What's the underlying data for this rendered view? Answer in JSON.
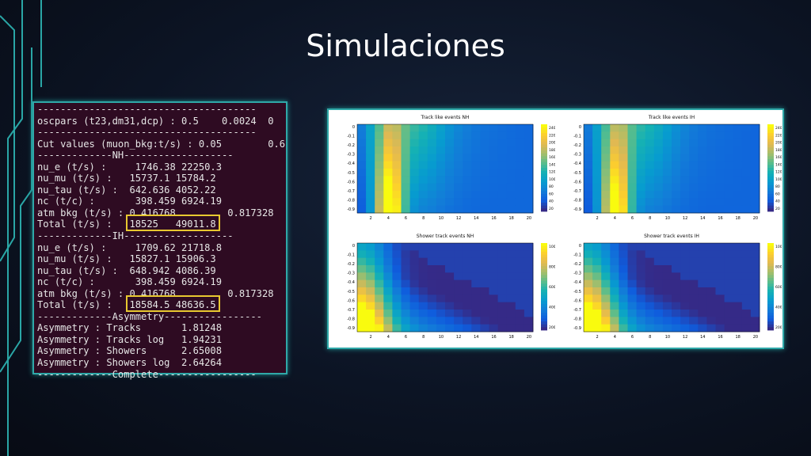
{
  "slide_title": "Simulaciones",
  "terminal_lines": [
    "--------------------------------------",
    "oscpars (t23,dm31,dcp) : 0.5    0.0024  0",
    "--------------------------------------",
    "Cut values (muon_bkg:t/s) : 0.05        0.6",
    "-------------NH-------------------",
    "nu_e (t/s) :     1746.38 22250.3",
    "nu_mu (t/s) :   15737.1 15784.2",
    "nu_tau (t/s) :  642.636 4052.22",
    "nc (t/c) :       398.459 6924.19",
    "atm bkg (t/s) : 0.416768         0.817328",
    "Total (t/s) :   18525   49011.8",
    "-------------IH-------------------",
    "nu_e (t/s) :     1709.62 21718.8",
    "nu_mu (t/s) :   15827.1 15906.3",
    "nu_tau (t/s) :  648.942 4086.39",
    "nc (t/c) :       398.459 6924.19",
    "atm bkg (t/s) : 0.416768         0.817328",
    "Total (t/s) :   18584.5 48636.5",
    "-------------Asymmetry-----------------",
    "Asymmetry : Tracks       1.81248",
    "Asymmetry : Tracks log   1.94231",
    "Asymmetry : Showers      2.65008",
    "Asymmetry : Showers log  2.64264",
    "-------------Complete-----------------"
  ],
  "plots": [
    {
      "title": "Track like events NH",
      "yticks": [
        "0",
        "-0.1",
        "-0.2",
        "-0.3",
        "-0.4",
        "-0.5",
        "-0.6",
        "-0.7",
        "-0.8",
        "-0.9"
      ],
      "xticks": [
        "2",
        "4",
        "6",
        "8",
        "10",
        "12",
        "14",
        "16",
        "18",
        "20"
      ],
      "zticks": [
        "240",
        "220",
        "200",
        "180",
        "160",
        "140",
        "120",
        "100",
        "80",
        "60",
        "40",
        "20"
      ]
    },
    {
      "title": "Track like events IH",
      "yticks": [
        "0",
        "-0.1",
        "-0.2",
        "-0.3",
        "-0.4",
        "-0.5",
        "-0.6",
        "-0.7",
        "-0.8",
        "-0.9"
      ],
      "xticks": [
        "2",
        "4",
        "6",
        "8",
        "10",
        "12",
        "14",
        "16",
        "18",
        "20"
      ],
      "zticks": [
        "240",
        "220",
        "200",
        "180",
        "160",
        "140",
        "120",
        "100",
        "80",
        "60",
        "40",
        "20"
      ]
    },
    {
      "title": "Shower track events NH",
      "yticks": [
        "0",
        "-0.1",
        "-0.2",
        "-0.3",
        "-0.4",
        "-0.5",
        "-0.6",
        "-0.7",
        "-0.8",
        "-0.9"
      ],
      "xticks": [
        "2",
        "4",
        "6",
        "8",
        "10",
        "12",
        "14",
        "16",
        "18",
        "20"
      ],
      "zticks": [
        "1000",
        "800",
        "600",
        "400",
        "200"
      ]
    },
    {
      "title": "Shower track events IH",
      "yticks": [
        "0",
        "-0.1",
        "-0.2",
        "-0.3",
        "-0.4",
        "-0.5",
        "-0.6",
        "-0.7",
        "-0.8",
        "-0.9"
      ],
      "xticks": [
        "2",
        "4",
        "6",
        "8",
        "10",
        "12",
        "14",
        "16",
        "18",
        "20"
      ],
      "zticks": [
        "1000",
        "800",
        "600",
        "400",
        "200"
      ]
    }
  ],
  "colors": {
    "accent": "#2fa8a8",
    "terminal_bg": "#2e0b22",
    "highlight": "#e8c830"
  }
}
